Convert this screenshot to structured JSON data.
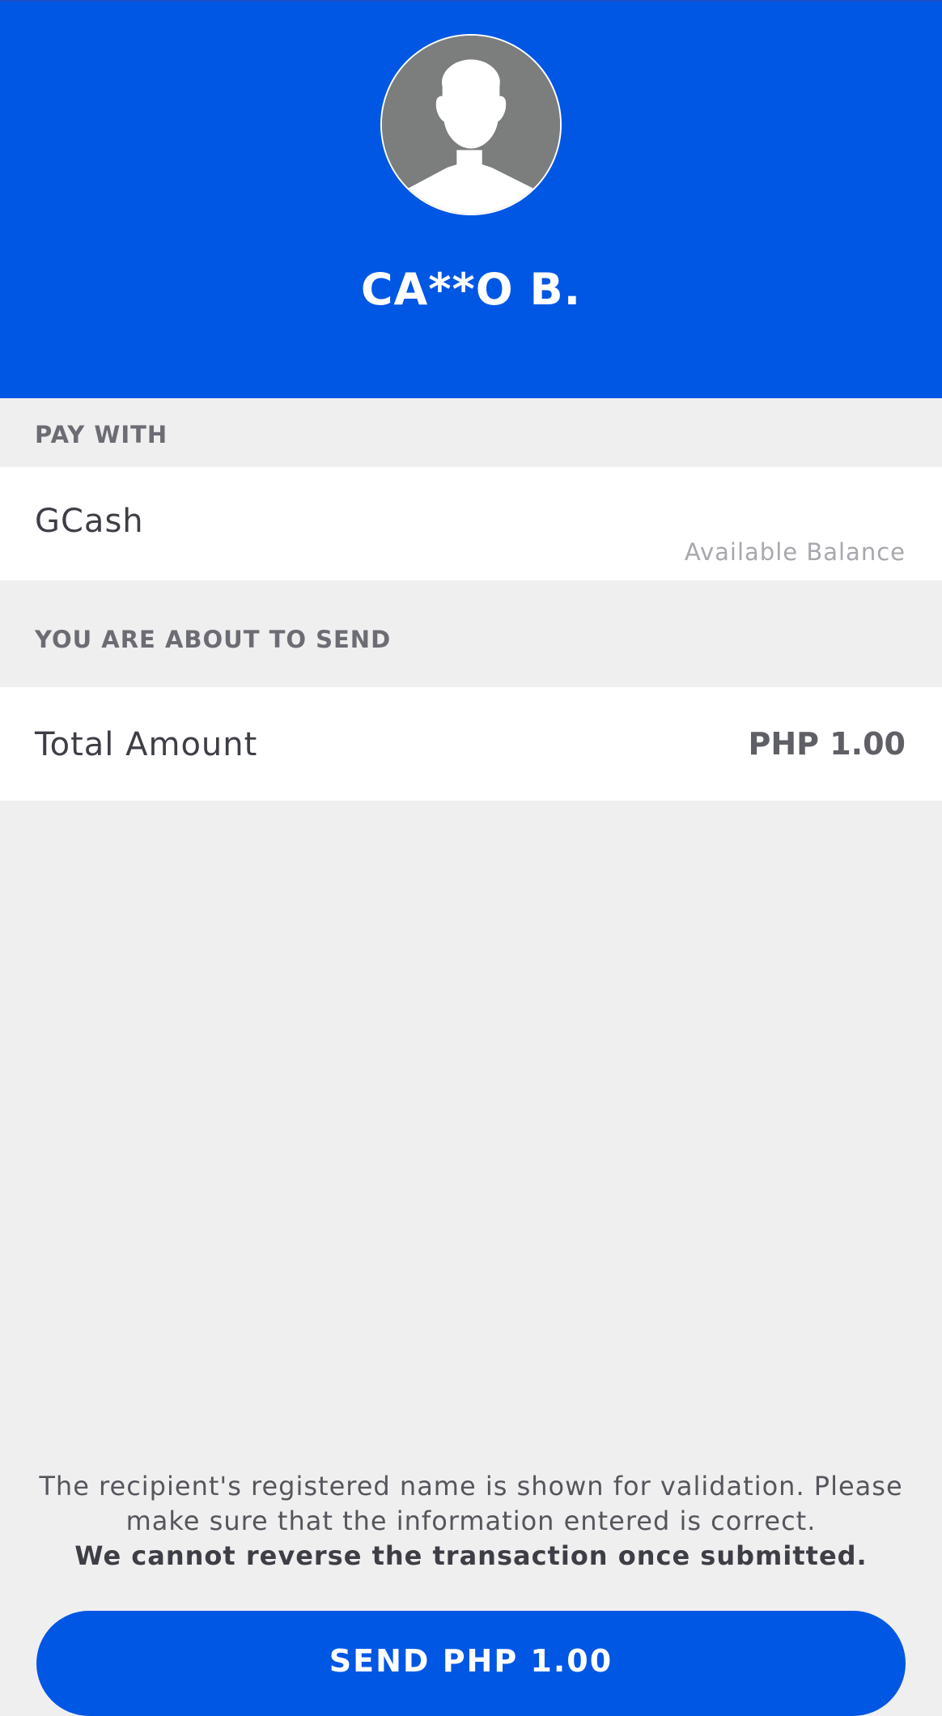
{
  "recipient": {
    "avatar_icon": "user-avatar-icon",
    "name": "CA**O B."
  },
  "pay_with": {
    "section_label": "PAY WITH",
    "wallet_name": "GCash",
    "balance_label": "Available Balance"
  },
  "send_summary": {
    "section_label": "YOU ARE ABOUT TO SEND",
    "total_label": "Total Amount",
    "total_value": "PHP 1.00"
  },
  "footer": {
    "disclaimer_text": "The recipient's registered name is shown for validation. Please make sure that the information entered is correct.",
    "disclaimer_bold": "We cannot reverse the transaction once submitted.",
    "send_button_label": "SEND PHP 1.00"
  },
  "colors": {
    "brand_blue": "#0057e4",
    "page_background": "#efefef",
    "card_background": "#ffffff",
    "avatar_gray": "#7c7d7d"
  }
}
